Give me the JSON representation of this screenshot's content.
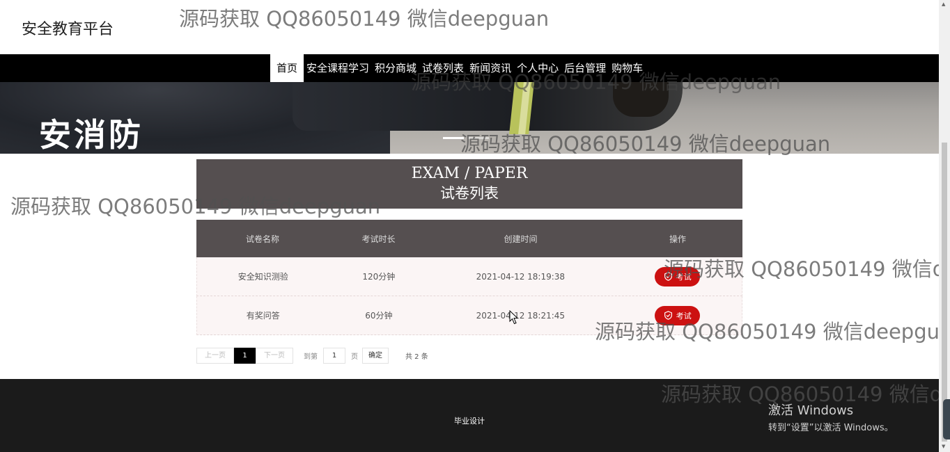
{
  "header": {
    "logo": "安全教育平台"
  },
  "nav": {
    "items": [
      {
        "label": "首页"
      },
      {
        "label": "安全课程学习"
      },
      {
        "label": "积分商城"
      },
      {
        "label": "试卷列表"
      },
      {
        "label": "新闻资讯"
      },
      {
        "label": "个人中心"
      },
      {
        "label": "后台管理"
      },
      {
        "label": "购物车"
      }
    ],
    "active_index": 0
  },
  "banner": {
    "text": "安消防"
  },
  "title_block": {
    "en": "EXAM / PAPER",
    "cn": "试卷列表"
  },
  "table": {
    "headers": [
      "试卷名称",
      "考试时长",
      "创建时间",
      "操作"
    ],
    "rows": [
      {
        "name": "安全知识测验",
        "duration": "120分钟",
        "created": "2021-04-12 18:19:38",
        "action": "考试"
      },
      {
        "name": "有奖问答",
        "duration": "60分钟",
        "created": "2021-04-12 18:21:45",
        "action": "考试"
      }
    ]
  },
  "pager": {
    "prev": "上一页",
    "current": "1",
    "next": "下一页",
    "goto_label": "到第",
    "goto_value": "1",
    "page_unit": "页",
    "ok": "确定",
    "total": "共 2 条"
  },
  "footer": {
    "text": "毕业设计"
  },
  "watermark": {
    "text": "源码获取 QQ86050149 微信deepguan",
    "text_cut_1": "源码获取 QQ86050149 微信de",
    "text_cut_2": "源码获取 QQ86050149 微信deepgua"
  },
  "os_notice": {
    "title": "激活 Windows",
    "subtitle": "转到“设置”以激活 Windows。"
  },
  "colors": {
    "nav_bg": "#000000",
    "panel": "#554f50",
    "exam_button": "#cc1111",
    "footer_bg": "#1b1b1b"
  }
}
